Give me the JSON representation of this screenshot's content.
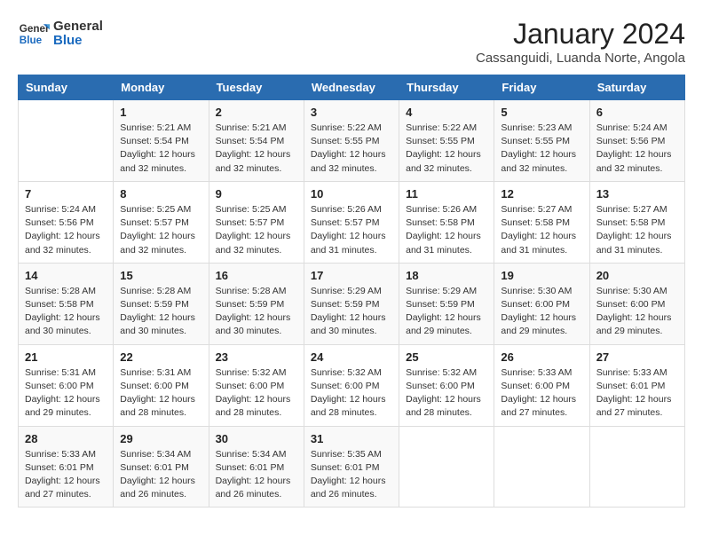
{
  "logo": {
    "line1": "General",
    "line2": "Blue"
  },
  "title": "January 2024",
  "location": "Cassanguidi, Luanda Norte, Angola",
  "days_of_week": [
    "Sunday",
    "Monday",
    "Tuesday",
    "Wednesday",
    "Thursday",
    "Friday",
    "Saturday"
  ],
  "weeks": [
    [
      {
        "day": "",
        "info": ""
      },
      {
        "day": "1",
        "info": "Sunrise: 5:21 AM\nSunset: 5:54 PM\nDaylight: 12 hours\nand 32 minutes."
      },
      {
        "day": "2",
        "info": "Sunrise: 5:21 AM\nSunset: 5:54 PM\nDaylight: 12 hours\nand 32 minutes."
      },
      {
        "day": "3",
        "info": "Sunrise: 5:22 AM\nSunset: 5:55 PM\nDaylight: 12 hours\nand 32 minutes."
      },
      {
        "day": "4",
        "info": "Sunrise: 5:22 AM\nSunset: 5:55 PM\nDaylight: 12 hours\nand 32 minutes."
      },
      {
        "day": "5",
        "info": "Sunrise: 5:23 AM\nSunset: 5:55 PM\nDaylight: 12 hours\nand 32 minutes."
      },
      {
        "day": "6",
        "info": "Sunrise: 5:24 AM\nSunset: 5:56 PM\nDaylight: 12 hours\nand 32 minutes."
      }
    ],
    [
      {
        "day": "7",
        "info": "Sunrise: 5:24 AM\nSunset: 5:56 PM\nDaylight: 12 hours\nand 32 minutes."
      },
      {
        "day": "8",
        "info": "Sunrise: 5:25 AM\nSunset: 5:57 PM\nDaylight: 12 hours\nand 32 minutes."
      },
      {
        "day": "9",
        "info": "Sunrise: 5:25 AM\nSunset: 5:57 PM\nDaylight: 12 hours\nand 32 minutes."
      },
      {
        "day": "10",
        "info": "Sunrise: 5:26 AM\nSunset: 5:57 PM\nDaylight: 12 hours\nand 31 minutes."
      },
      {
        "day": "11",
        "info": "Sunrise: 5:26 AM\nSunset: 5:58 PM\nDaylight: 12 hours\nand 31 minutes."
      },
      {
        "day": "12",
        "info": "Sunrise: 5:27 AM\nSunset: 5:58 PM\nDaylight: 12 hours\nand 31 minutes."
      },
      {
        "day": "13",
        "info": "Sunrise: 5:27 AM\nSunset: 5:58 PM\nDaylight: 12 hours\nand 31 minutes."
      }
    ],
    [
      {
        "day": "14",
        "info": "Sunrise: 5:28 AM\nSunset: 5:58 PM\nDaylight: 12 hours\nand 30 minutes."
      },
      {
        "day": "15",
        "info": "Sunrise: 5:28 AM\nSunset: 5:59 PM\nDaylight: 12 hours\nand 30 minutes."
      },
      {
        "day": "16",
        "info": "Sunrise: 5:28 AM\nSunset: 5:59 PM\nDaylight: 12 hours\nand 30 minutes."
      },
      {
        "day": "17",
        "info": "Sunrise: 5:29 AM\nSunset: 5:59 PM\nDaylight: 12 hours\nand 30 minutes."
      },
      {
        "day": "18",
        "info": "Sunrise: 5:29 AM\nSunset: 5:59 PM\nDaylight: 12 hours\nand 29 minutes."
      },
      {
        "day": "19",
        "info": "Sunrise: 5:30 AM\nSunset: 6:00 PM\nDaylight: 12 hours\nand 29 minutes."
      },
      {
        "day": "20",
        "info": "Sunrise: 5:30 AM\nSunset: 6:00 PM\nDaylight: 12 hours\nand 29 minutes."
      }
    ],
    [
      {
        "day": "21",
        "info": "Sunrise: 5:31 AM\nSunset: 6:00 PM\nDaylight: 12 hours\nand 29 minutes."
      },
      {
        "day": "22",
        "info": "Sunrise: 5:31 AM\nSunset: 6:00 PM\nDaylight: 12 hours\nand 28 minutes."
      },
      {
        "day": "23",
        "info": "Sunrise: 5:32 AM\nSunset: 6:00 PM\nDaylight: 12 hours\nand 28 minutes."
      },
      {
        "day": "24",
        "info": "Sunrise: 5:32 AM\nSunset: 6:00 PM\nDaylight: 12 hours\nand 28 minutes."
      },
      {
        "day": "25",
        "info": "Sunrise: 5:32 AM\nSunset: 6:00 PM\nDaylight: 12 hours\nand 28 minutes."
      },
      {
        "day": "26",
        "info": "Sunrise: 5:33 AM\nSunset: 6:00 PM\nDaylight: 12 hours\nand 27 minutes."
      },
      {
        "day": "27",
        "info": "Sunrise: 5:33 AM\nSunset: 6:01 PM\nDaylight: 12 hours\nand 27 minutes."
      }
    ],
    [
      {
        "day": "28",
        "info": "Sunrise: 5:33 AM\nSunset: 6:01 PM\nDaylight: 12 hours\nand 27 minutes."
      },
      {
        "day": "29",
        "info": "Sunrise: 5:34 AM\nSunset: 6:01 PM\nDaylight: 12 hours\nand 26 minutes."
      },
      {
        "day": "30",
        "info": "Sunrise: 5:34 AM\nSunset: 6:01 PM\nDaylight: 12 hours\nand 26 minutes."
      },
      {
        "day": "31",
        "info": "Sunrise: 5:35 AM\nSunset: 6:01 PM\nDaylight: 12 hours\nand 26 minutes."
      },
      {
        "day": "",
        "info": ""
      },
      {
        "day": "",
        "info": ""
      },
      {
        "day": "",
        "info": ""
      }
    ]
  ]
}
